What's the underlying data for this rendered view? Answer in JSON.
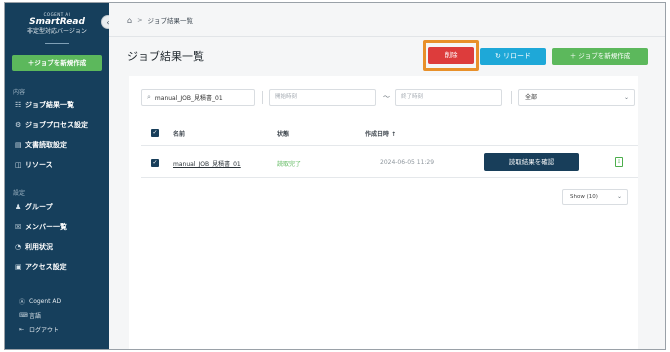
{
  "sidebar": {
    "brand_small": "COGENT AI",
    "brand_main": "SmartRead",
    "brand_sub": "非定型対応バージョン",
    "collapse_icon": "‹",
    "new_job_label": "＋ジョブを新規作成",
    "section_content": "内容",
    "content_items": [
      {
        "icon": "☷",
        "label": "ジョブ結果一覧"
      },
      {
        "icon": "⚙",
        "label": "ジョブプロセス設定"
      },
      {
        "icon": "▤",
        "label": "文書読取設定"
      },
      {
        "icon": "◫",
        "label": "リソース"
      }
    ],
    "section_settings": "設定",
    "settings_items": [
      {
        "icon": "♟",
        "label": "グループ"
      },
      {
        "icon": "☒",
        "label": "メンバー一覧"
      },
      {
        "icon": "◔",
        "label": "利用状況"
      },
      {
        "icon": "▣",
        "label": "アクセス設定"
      }
    ],
    "footer": [
      {
        "icon": "Ⓐ",
        "label": "Cogent AD"
      },
      {
        "icon": "⌨",
        "label": "言語"
      },
      {
        "icon": "⇤",
        "label": "ログアウト"
      }
    ]
  },
  "breadcrumb": {
    "home_icon": "⌂",
    "separator": ">",
    "current": "ジョブ結果一覧"
  },
  "page_title": "ジョブ結果一覧",
  "toolbar": {
    "delete_label": "削除",
    "reload_label": "↻ リロード",
    "new_job_label": "＋ ジョブを新規作成"
  },
  "filters": {
    "search_icon": "⌕",
    "search_value": "manual_JOB_見積書_01",
    "start_placeholder": "開始時刻",
    "tilde": "～",
    "end_placeholder": "終了時刻",
    "status_value": "全部",
    "chevron": "⌄"
  },
  "table": {
    "check_mark": "✓",
    "headers": {
      "name": "名前",
      "status": "状態",
      "created": "作成日時 ↑"
    },
    "rows": [
      {
        "name": "manual_JOB_見積書_01",
        "status": "読取完了",
        "created": "2024-06-05 11:29",
        "action_label": "読取結果を確認",
        "doc_icon": "⇩"
      }
    ]
  },
  "pagination": {
    "page_size": "Show (10)",
    "chevron": "⌄"
  },
  "colors": {
    "sidebar_bg": "#163f5c",
    "delete": "#dd3c3c",
    "reload": "#1ea8d8",
    "create": "#5cb85c",
    "status_done": "#5cb85c",
    "highlight_border": "#e8902a"
  }
}
